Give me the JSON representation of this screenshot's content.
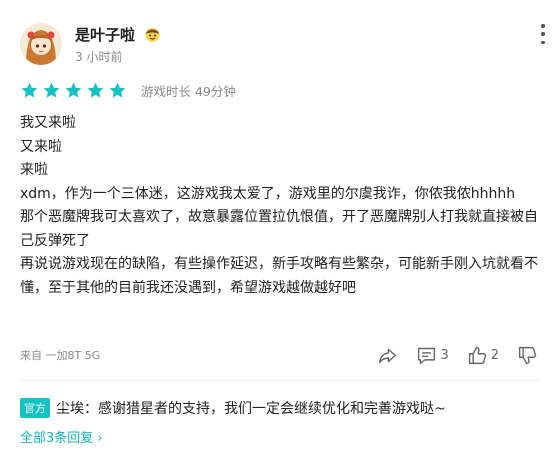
{
  "user": {
    "name": "是叶子啦",
    "badge_icon": "emoji-face-icon",
    "avatar_icon": "anime-girl-avatar",
    "time_ago": "3 小时前"
  },
  "rating": {
    "stars": 5,
    "max_stars": 5,
    "star_color": "#14c2c4",
    "playtime": "游戏时长 49分钟"
  },
  "review": {
    "lines": [
      "我又来啦",
      "又来啦",
      "来啦",
      "xdm，作为一个三体迷，这游戏我太爱了，游戏里的尔虞我诈，你侬我侬hhhhh",
      "那个恶魔牌我可太喜欢了，故意暴露位置拉仇恨值，开了恶魔牌别人打我就直接被自己反弹死了",
      "再说说游戏现在的缺陷，有些操作延迟，新手攻略有些繁杂，可能新手刚入坑就看不懂，至于其他的目前我还没遇到，希望游戏越做越好吧"
    ]
  },
  "device": "来自 一加8T 5G",
  "actions": {
    "share_icon": "share-icon",
    "comment_count": "3",
    "like_count": "2",
    "dislike_icon": "thumbs-down-icon"
  },
  "official_reply": {
    "badge": "官方",
    "author": "尘埃",
    "separator": "：",
    "text": "感谢猎星者的支持，我们一定会继续优化和完善游戏哒~"
  },
  "all_replies_label": "全部3条回复",
  "all_replies_chevron": "›",
  "accent_color": "#14c2c4"
}
